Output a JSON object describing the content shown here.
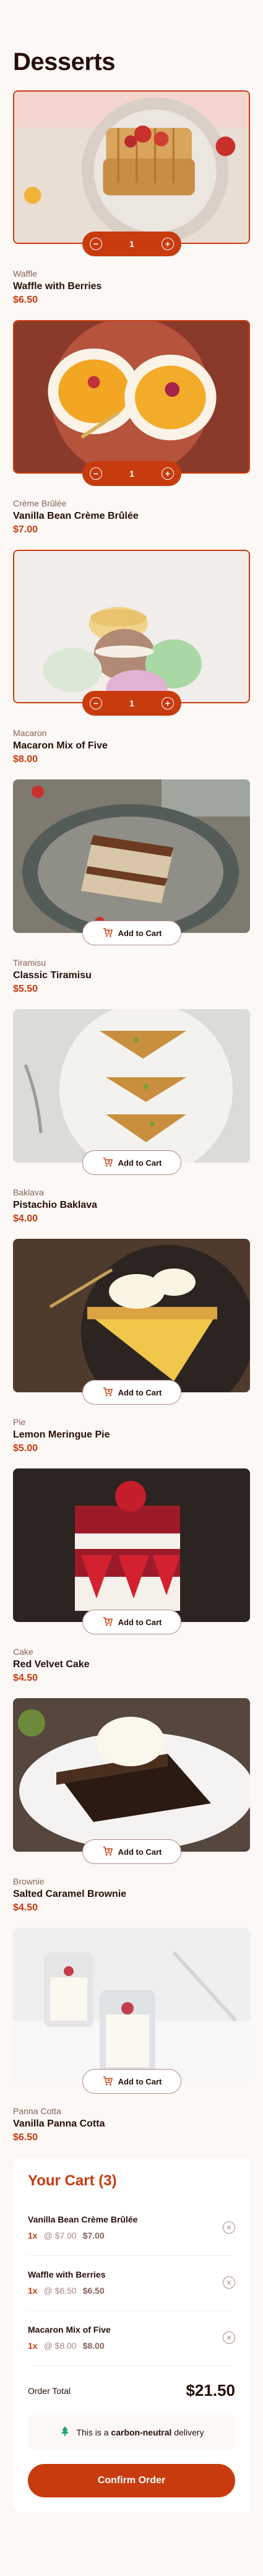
{
  "page_title": "Desserts",
  "add_to_cart_label": "Add to Cart",
  "products": [
    {
      "category": "Waffle",
      "name": "Waffle with Berries",
      "price": "$6.50",
      "in_cart": true,
      "qty": "1",
      "image": "waffle"
    },
    {
      "category": "Crème Brûlée",
      "name": "Vanilla Bean Crème Brûlée",
      "price": "$7.00",
      "in_cart": true,
      "qty": "1",
      "image": "creme-brulee"
    },
    {
      "category": "Macaron",
      "name": "Macaron Mix of Five",
      "price": "$8.00",
      "in_cart": true,
      "qty": "1",
      "image": "macaron"
    },
    {
      "category": "Tiramisu",
      "name": "Classic Tiramisu",
      "price": "$5.50",
      "in_cart": false,
      "qty": "0",
      "image": "tiramisu"
    },
    {
      "category": "Baklava",
      "name": "Pistachio Baklava",
      "price": "$4.00",
      "in_cart": false,
      "qty": "0",
      "image": "baklava"
    },
    {
      "category": "Pie",
      "name": "Lemon Meringue Pie",
      "price": "$5.00",
      "in_cart": false,
      "qty": "0",
      "image": "pie"
    },
    {
      "category": "Cake",
      "name": "Red Velvet Cake",
      "price": "$4.50",
      "in_cart": false,
      "qty": "0",
      "image": "cake"
    },
    {
      "category": "Brownie",
      "name": "Salted Caramel Brownie",
      "price": "$4.50",
      "in_cart": false,
      "qty": "0",
      "image": "brownie"
    },
    {
      "category": "Panna Cotta",
      "name": "Vanilla Panna Cotta",
      "price": "$6.50",
      "in_cart": false,
      "qty": "0",
      "image": "panna-cotta"
    }
  ],
  "cart": {
    "title": "Your Cart (3)",
    "items": [
      {
        "name": "Vanilla Bean Crème Brûlée",
        "qty": "1x",
        "unit": "@ $7.00",
        "subtotal": "$7.00"
      },
      {
        "name": "Waffle with Berries",
        "qty": "1x",
        "unit": "@ $6.50",
        "subtotal": "$6.50"
      },
      {
        "name": "Macaron Mix of Five",
        "qty": "1x",
        "unit": "@ $8.00",
        "subtotal": "$8.00"
      }
    ],
    "order_total_label": "Order Total",
    "order_total": "$21.50",
    "carbon_prefix": "This is a",
    "carbon_bold": "carbon-neutral",
    "carbon_suffix": "delivery",
    "confirm_label": "Confirm Order"
  },
  "colors": {
    "accent": "#c73b0f",
    "background": "#fcf8f5",
    "text": "#260f08",
    "muted": "#87635a",
    "carbon_green": "#1ea575"
  }
}
